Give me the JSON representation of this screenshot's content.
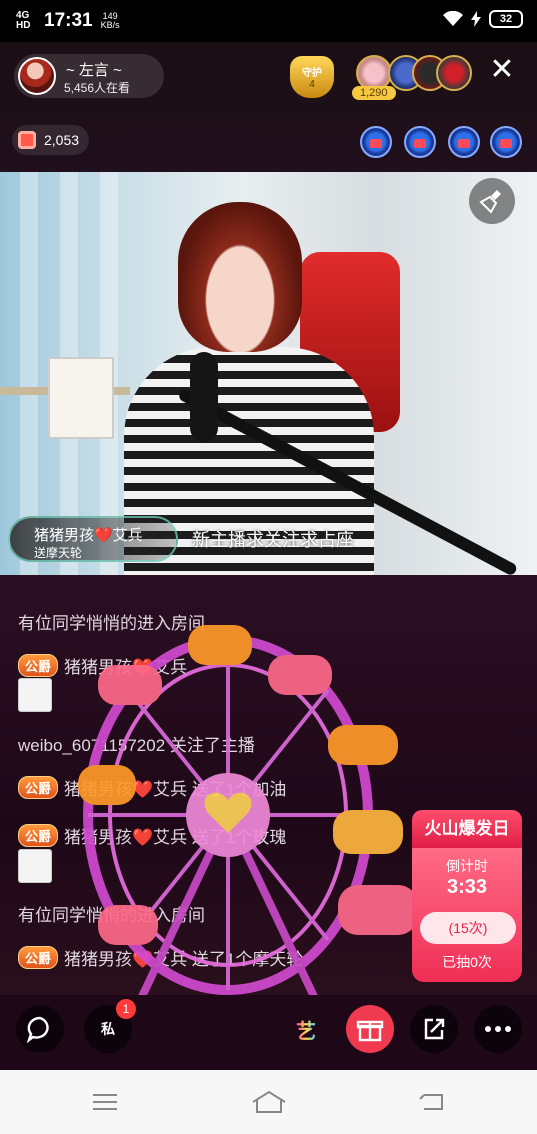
{
  "status_bar": {
    "network": "4G HD",
    "time": "17:31",
    "speed_value": "149",
    "speed_unit": "KB/s",
    "battery": "32"
  },
  "host": {
    "name": "~ 左言 ~",
    "viewers": "5,456人在看"
  },
  "guard": {
    "label": "守护",
    "count": "4"
  },
  "fans": {
    "count": "1,290"
  },
  "coins": "2,053",
  "video": {
    "gift_banner_user": "猪猪男孩❤️艾兵",
    "gift_banner_gift": "送摩天轮",
    "host_notice": "新主播求关注求占座"
  },
  "chat": {
    "messages": [
      {
        "text": "有位同学悄悄的进入房间"
      },
      {
        "badge": "公爵",
        "text": "猪猪男孩❤️艾兵"
      },
      {
        "text": "weibo_6071157202 关注了主播"
      },
      {
        "badge": "公爵",
        "text": "猪猪男孩❤️艾兵 送了1个加油"
      },
      {
        "badge": "公爵",
        "text": "猪猪男孩❤️艾兵 送了1个玫瑰"
      },
      {
        "text": "有位同学悄悄的进入房间"
      },
      {
        "badge": "公爵",
        "text": "猪猪男孩❤️艾兵 送了1个摩天轮"
      }
    ]
  },
  "lottery": {
    "title": "火山爆发日",
    "subtitle": "倒计时",
    "timer": "3:33",
    "button": "(15次)",
    "drawn": "已抽0次"
  },
  "toolbar": {
    "pm_label": "私",
    "pm_badge": "1",
    "art_label": "艺"
  },
  "colors": {
    "accent": "#ff3a5a",
    "chat_bg": "#1e0818",
    "noble_badge": "#e0531c",
    "gift_button": "#f03a50"
  }
}
